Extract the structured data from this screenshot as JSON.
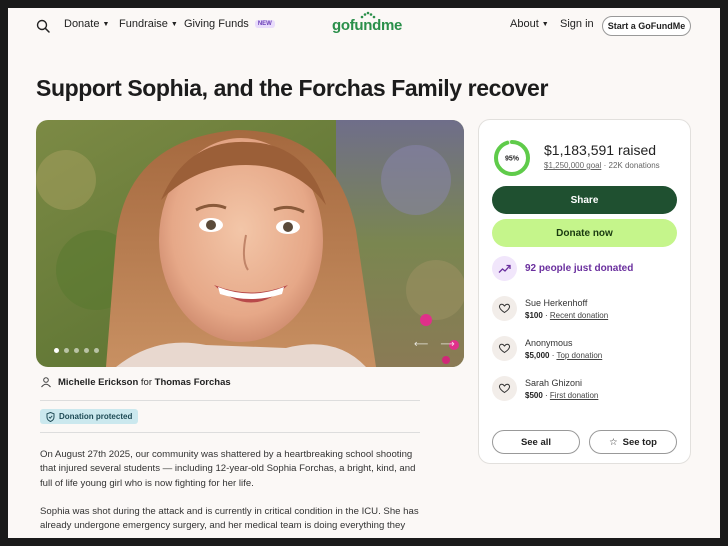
{
  "header": {
    "nav": [
      "Donate",
      "Fundraise",
      "Giving Funds"
    ],
    "new_badge": "NEW",
    "logo": "gofundme",
    "about": "About",
    "signin": "Sign in",
    "start": "Start a GoFundMe"
  },
  "title": "Support Sophia, and the Forchas Family recover",
  "organizer": {
    "name": "Michelle Erickson",
    "for_word": "for",
    "beneficiary": "Thomas Forchas"
  },
  "protected_label": "Donation protected",
  "story": [
    "On August 27th 2025, our community was shattered by a heartbreaking school shooting that injured several students — including 12-year-old Sophia Forchas, a bright, kind, and full of life young girl who is now fighting for her life.",
    "Sophia was shot during the attack and is currently in critical condition in the ICU. She has already undergone emergency surgery, and her medical team is doing everything they"
  ],
  "card": {
    "percent": "95%",
    "progress_fraction": 0.95,
    "raised": "$1,183,591 raised",
    "goal": "$1,250,000 goal",
    "donations": "22K donations",
    "share": "Share",
    "donate": "Donate now",
    "just_donated": "92 people just donated",
    "donors": [
      {
        "name": "Sue Herkenhoff",
        "amount": "$100",
        "tag": "Recent donation"
      },
      {
        "name": "Anonymous",
        "amount": "$5,000",
        "tag": "Top donation"
      },
      {
        "name": "Sarah Ghizoni",
        "amount": "$500",
        "tag": "First donation"
      }
    ],
    "see_all": "See all",
    "see_top": "See top"
  },
  "colors": {
    "brand_green": "#2a8f4a",
    "share_bg": "#1f5030",
    "donate_bg": "#c5f58b",
    "progress": "#5fcb4a",
    "accent_purple": "#6a2f9e"
  }
}
